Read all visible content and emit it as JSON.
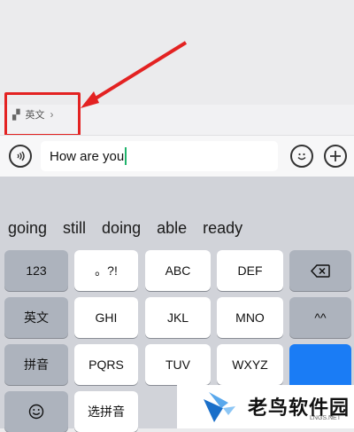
{
  "translate": {
    "glyph": "▞",
    "label": "英文",
    "chevron": "›"
  },
  "input": {
    "value": "How are you"
  },
  "suggestions": [
    "going",
    "still",
    "doing",
    "able",
    "ready"
  ],
  "keys": {
    "k123": "123",
    "punct": "。?!",
    "abc": "ABC",
    "def": "DEF",
    "english": "英文",
    "ghi": "GHI",
    "jkl": "JKL",
    "mno": "MNO",
    "face": "^^",
    "pinyin": "拼音",
    "pqrs": "PQRS",
    "tuv": "TUV",
    "wxyz": "WXYZ",
    "select_pinyin": "选拼音"
  },
  "watermark": {
    "title": "老鸟软件园",
    "sub": "LNGS.NET"
  },
  "colors": {
    "highlight": "#e32222",
    "caret": "#1fb36b",
    "key_blue": "#1a7cf5"
  }
}
